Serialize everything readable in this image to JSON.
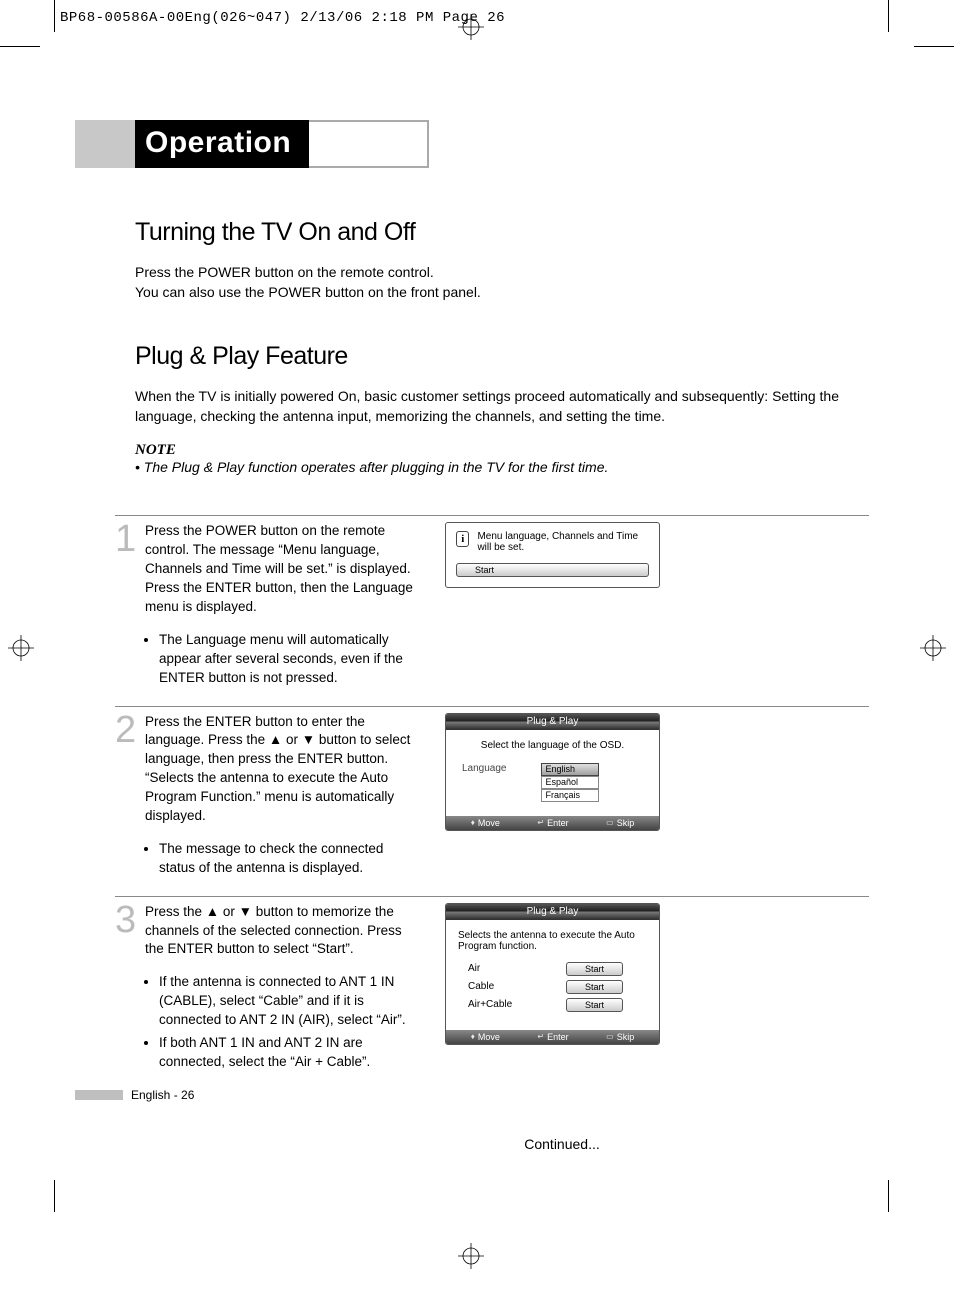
{
  "header": "BP68-00586A-00Eng(026~047)  2/13/06  2:18 PM  Page 26",
  "section_title": "Operation",
  "h2_a": "Turning the TV On and Off",
  "para_a": "Press the POWER button on the remote control.\nYou can also use the POWER button on the front panel.",
  "h2_b": "Plug & Play Feature",
  "para_b": "When the TV is initially powered On, basic customer settings proceed automatically and subsequently: Setting the language, checking the antenna input, memorizing the channels, and setting the time.",
  "note_label": "NOTE",
  "note_text": "• The Plug & Play function operates after plugging in the TV for the first time.",
  "steps": [
    {
      "num": "1",
      "text": "Press the POWER button on the remote control. The message “Menu language, Channels and Time will be set.” is displayed.\nPress the ENTER button, then the Language menu is displayed.",
      "bullets": [
        "The Language menu will automatically appear after several seconds, even if the ENTER button is not pressed."
      ]
    },
    {
      "num": "2",
      "text": "Press the ENTER button to enter the language. Press the ▲ or ▼ button to select language, then press the ENTER button. “Selects the antenna to execute the Auto Program Function.” menu is automatically displayed.",
      "bullets": [
        "The message to check the connected status of the antenna is displayed."
      ]
    },
    {
      "num": "3",
      "text": "Press the ▲ or ▼ button to memorize the channels of the selected connection. Press the ENTER button to select “Start”.",
      "bullets": [
        "If the antenna is connected to ANT 1 IN (CABLE), select “Cable” and if it is connected to ANT 2 IN (AIR), select “Air”.",
        "If both ANT 1 IN and ANT 2 IN are connected, select the “Air + Cable”."
      ]
    }
  ],
  "osd1": {
    "msg": "Menu language, Channels and Time will be set.",
    "btn": "Start"
  },
  "osd2": {
    "title": "Plug & Play",
    "prompt": "Select the language of the OSD.",
    "label": "Language",
    "options": [
      "English",
      "Español",
      "Français"
    ],
    "footer": {
      "move": "Move",
      "enter": "Enter",
      "skip": "Skip"
    }
  },
  "osd3": {
    "title": "Plug & Play",
    "prompt": "Selects the antenna to execute the Auto Program function.",
    "rows": [
      {
        "label": "Air",
        "btn": "Start"
      },
      {
        "label": "Cable",
        "btn": "Start"
      },
      {
        "label": "Air+Cable",
        "btn": "Start"
      }
    ],
    "footer": {
      "move": "Move",
      "enter": "Enter",
      "skip": "Skip"
    }
  },
  "continued": "Continued...",
  "footer_text": "English - 26"
}
